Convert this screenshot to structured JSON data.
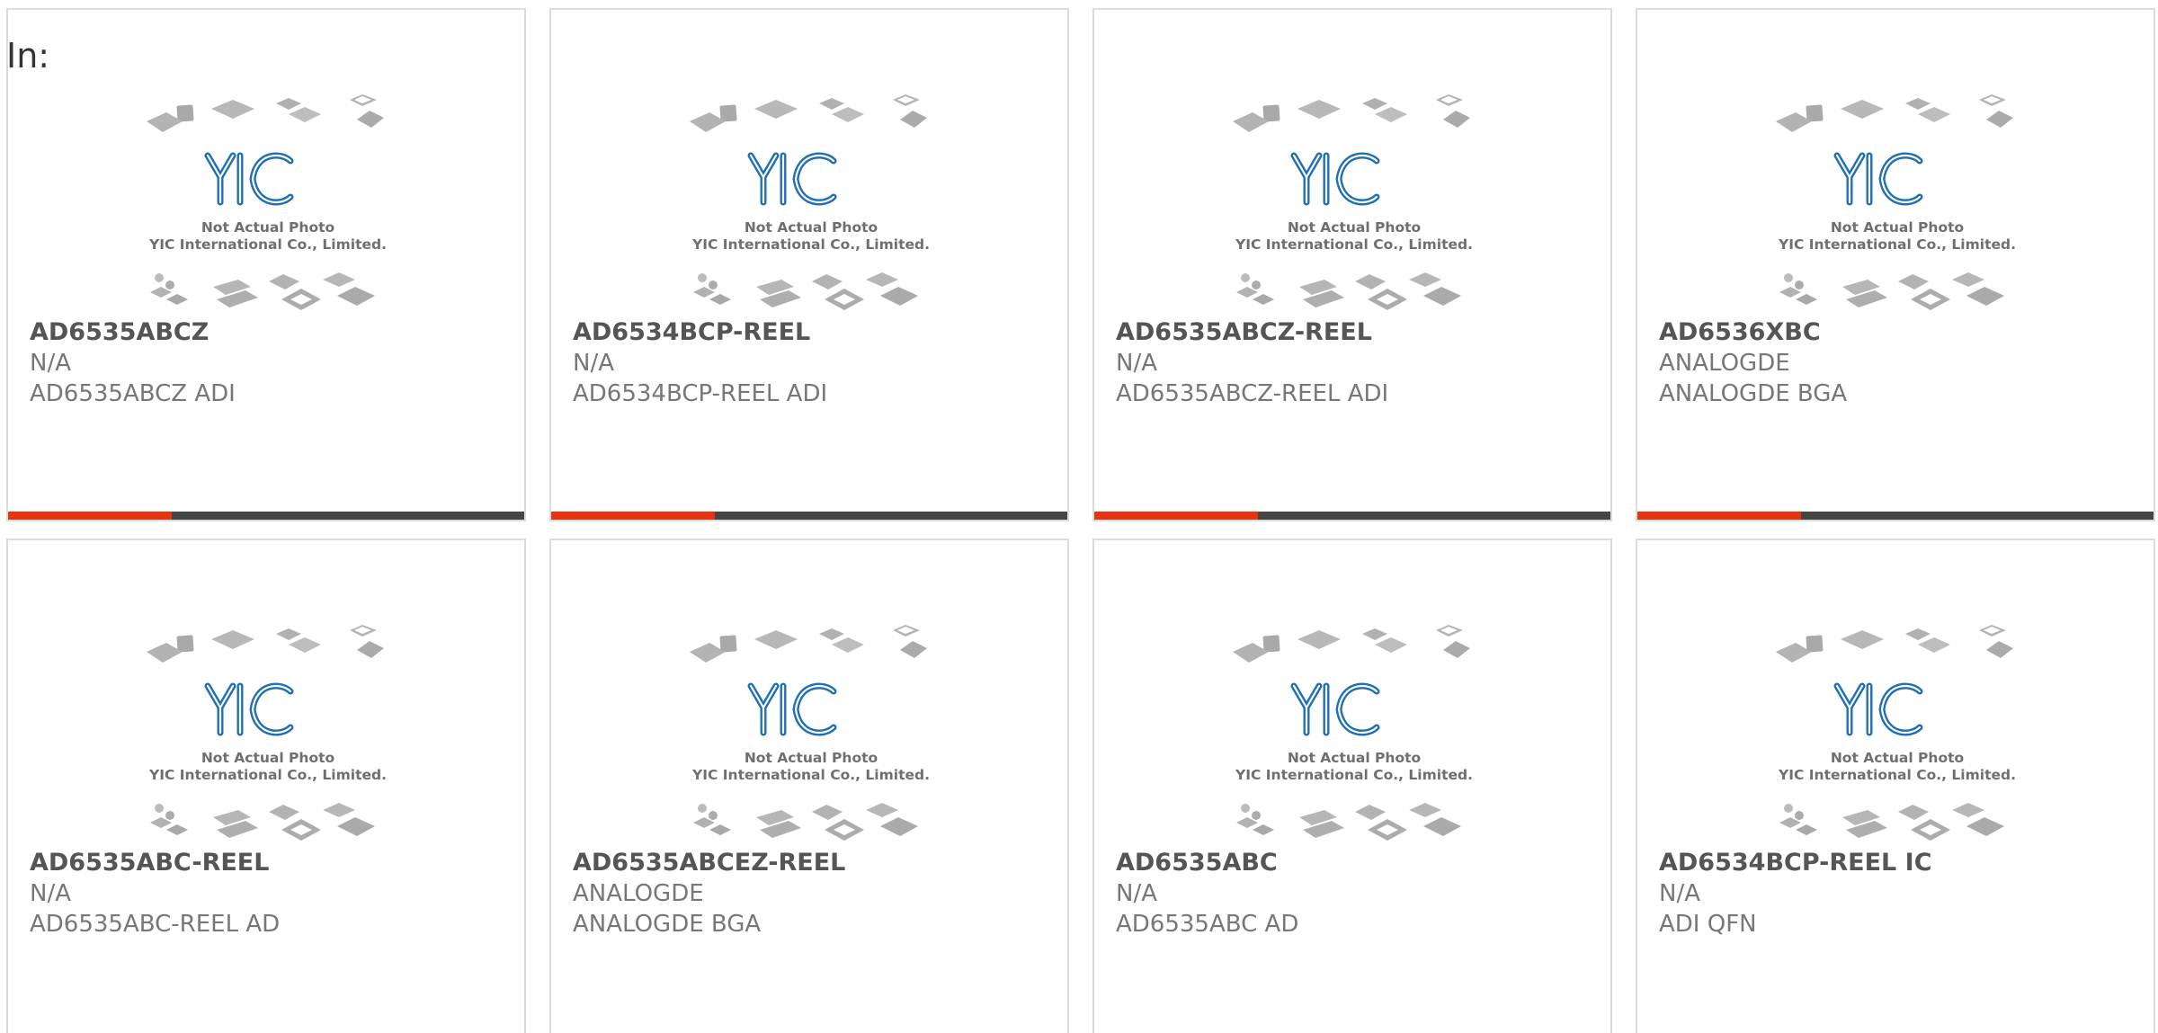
{
  "page": {
    "prefix": "In:"
  },
  "placeholder_image": {
    "line1": "Not Actual Photo",
    "line2": "YIC International Co., Limited.",
    "logo_text": "YIC",
    "logo_color": "#1e6fb4",
    "chip_color": "#b9b9b9"
  },
  "colors": {
    "accent_bar": "#e63312",
    "bar_track": "#444444",
    "card_border": "#dcdcdc"
  },
  "products": [
    {
      "part": "AD6535ABCZ",
      "manufacturer": "N/A",
      "description": "AD6535ABCZ ADI"
    },
    {
      "part": "AD6534BCP-REEL",
      "manufacturer": "N/A",
      "description": "AD6534BCP-REEL ADI"
    },
    {
      "part": "AD6535ABCZ-REEL",
      "manufacturer": "N/A",
      "description": "AD6535ABCZ-REEL ADI"
    },
    {
      "part": "AD6536XBC",
      "manufacturer": "ANALOGDE",
      "description": "ANALOGDE BGA"
    },
    {
      "part": "AD6535ABC-REEL",
      "manufacturer": "N/A",
      "description": "AD6535ABC-REEL AD"
    },
    {
      "part": "AD6535ABCEZ-REEL",
      "manufacturer": "ANALOGDE",
      "description": "ANALOGDE BGA"
    },
    {
      "part": "AD6535ABC",
      "manufacturer": "N/A",
      "description": "AD6535ABC AD"
    },
    {
      "part": "AD6534BCP-REEL IC",
      "manufacturer": "N/A",
      "description": "ADI QFN"
    }
  ]
}
